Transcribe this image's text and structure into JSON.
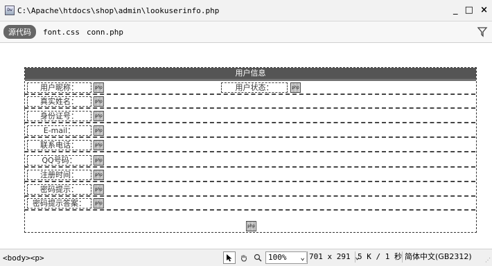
{
  "window": {
    "app_icon": "Dw",
    "title_path": "C:\\Apache\\htdocs\\shop\\admin\\lookuserinfo.php",
    "min_label": "_",
    "max_label": "□",
    "close_label": "×"
  },
  "filebar": {
    "source_button": "源代码",
    "files": [
      "font.css",
      "conn.php"
    ],
    "filter_icon": "filter-icon"
  },
  "design": {
    "header": "用户信息",
    "placeholder": "php",
    "rows": [
      {
        "label": "用户昵称：",
        "label2": "用户状态："
      },
      {
        "label": "真实姓名："
      },
      {
        "label": "身份证号："
      },
      {
        "label": "E-mail："
      },
      {
        "label": "联系电话："
      },
      {
        "label": "QQ号码："
      },
      {
        "label": "注册时间："
      },
      {
        "label": "密码提示："
      },
      {
        "label": "密码提示答案："
      }
    ]
  },
  "statusbar": {
    "tag_body": "<body>",
    "tag_p": "<p>",
    "tools": [
      "select-pointer-icon",
      "hand-icon",
      "zoom-icon"
    ],
    "zoom": "100%",
    "dimensions": "701 x 291",
    "file_size": "5 K / 1 秒",
    "encoding": "简体中文(GB2312)"
  }
}
